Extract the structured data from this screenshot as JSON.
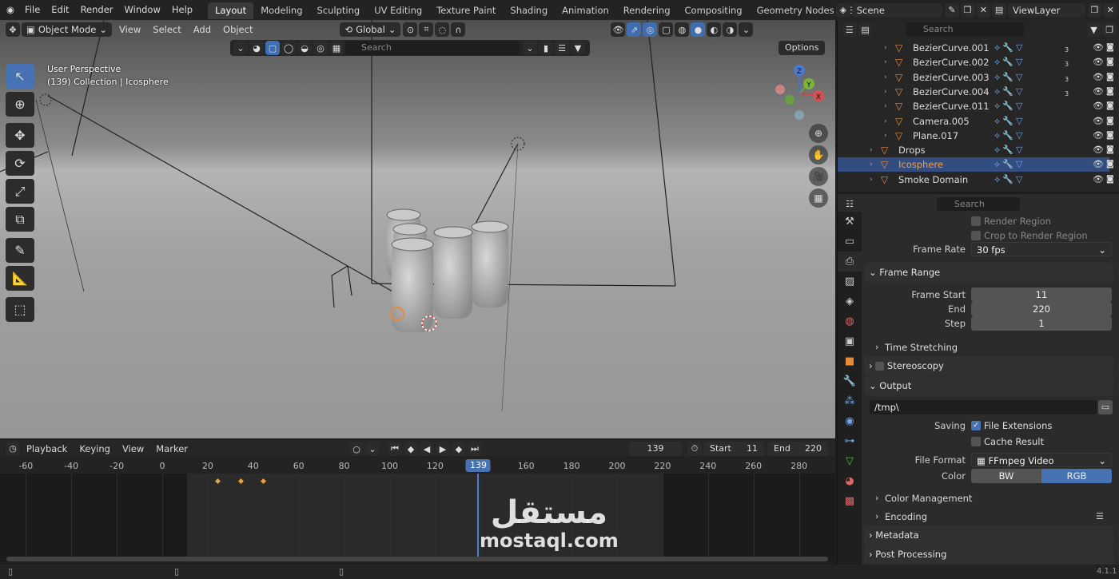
{
  "menu": [
    "File",
    "Edit",
    "Render",
    "Window",
    "Help"
  ],
  "workspaces": [
    {
      "label": "Layout",
      "active": true
    },
    {
      "label": "Modeling"
    },
    {
      "label": "Sculpting"
    },
    {
      "label": "UV Editing"
    },
    {
      "label": "Texture Paint"
    },
    {
      "label": "Shading"
    },
    {
      "label": "Animation"
    },
    {
      "label": "Rendering"
    },
    {
      "label": "Compositing"
    },
    {
      "label": "Geometry Nodes"
    },
    {
      "label": "Scripting"
    }
  ],
  "add_workspace": "+",
  "scene": {
    "label": "Scene",
    "view_layer": "ViewLayer"
  },
  "viewport": {
    "mode": "Object Mode",
    "menus": [
      "View",
      "Select",
      "Add",
      "Object"
    ],
    "transform_orientation": "Global",
    "search_placeholder": "Search",
    "options_label": "Options",
    "info_line1": "User Perspective",
    "info_line2": "(139) Collection | Icosphere",
    "gizmo": {
      "x": "X",
      "y": "Y",
      "z": "Z"
    }
  },
  "outliner": {
    "search_placeholder": "Search",
    "rows": [
      {
        "label": "BezierCurve.001",
        "badge": "3"
      },
      {
        "label": "BezierCurve.002",
        "badge": "3"
      },
      {
        "label": "BezierCurve.003",
        "badge": "3"
      },
      {
        "label": "BezierCurve.004",
        "badge": "3"
      },
      {
        "label": "BezierCurve.011",
        "badge": ""
      },
      {
        "label": "Camera.005",
        "badge": ""
      },
      {
        "label": "Plane.017",
        "badge": ""
      },
      {
        "label": "Drops",
        "badge": ""
      },
      {
        "label": "Icosphere",
        "badge": "",
        "selected": true
      },
      {
        "label": "Smoke Domain",
        "badge": ""
      }
    ]
  },
  "properties": {
    "search_placeholder": "Search",
    "render_region": "Render Region",
    "crop_region": "Crop to Render Region",
    "frame_rate_label": "Frame Rate",
    "frame_rate_value": "30 fps",
    "frame_range_title": "Frame Range",
    "frame_start_label": "Frame Start",
    "frame_start": "11",
    "end_label": "End",
    "end": "220",
    "step_label": "Step",
    "step": "1",
    "time_stretching": "Time Stretching",
    "stereoscopy": "Stereoscopy",
    "output_title": "Output",
    "output_path": "/tmp\\",
    "saving_label": "Saving",
    "file_extensions": "File Extensions",
    "cache_result": "Cache Result",
    "file_format_label": "File Format",
    "file_format_value": "FFmpeg Video",
    "color_label": "Color",
    "color_bw": "BW",
    "color_rgb": "RGB",
    "color_management": "Color Management",
    "encoding": "Encoding",
    "metadata": "Metadata",
    "post_processing": "Post Processing"
  },
  "timeline": {
    "menus": [
      "Playback",
      "Keying",
      "View",
      "Marker"
    ],
    "current_frame": "139",
    "start_label": "Start",
    "start": "11",
    "end_label": "End",
    "end": "220",
    "ticks": [
      "-60",
      "-40",
      "-20",
      "0",
      "20",
      "40",
      "60",
      "80",
      "100",
      "120",
      "140",
      "160",
      "180",
      "200",
      "220",
      "240",
      "260",
      "280"
    ],
    "tick_values": [
      -60,
      -40,
      -20,
      0,
      20,
      40,
      60,
      80,
      100,
      120,
      140,
      160,
      180,
      200,
      220,
      240,
      260,
      280
    ],
    "keyframes": [
      11,
      21,
      31
    ],
    "range": [
      11,
      220
    ]
  },
  "watermark": {
    "arabic": "مستقل",
    "latin": "mostaql.com"
  },
  "version": "4.1.1",
  "colors": {
    "accent": "#4772b3",
    "selected_row": "#334d80",
    "keyframe": "#e6a34a",
    "object_icon": "#e88a3a"
  }
}
